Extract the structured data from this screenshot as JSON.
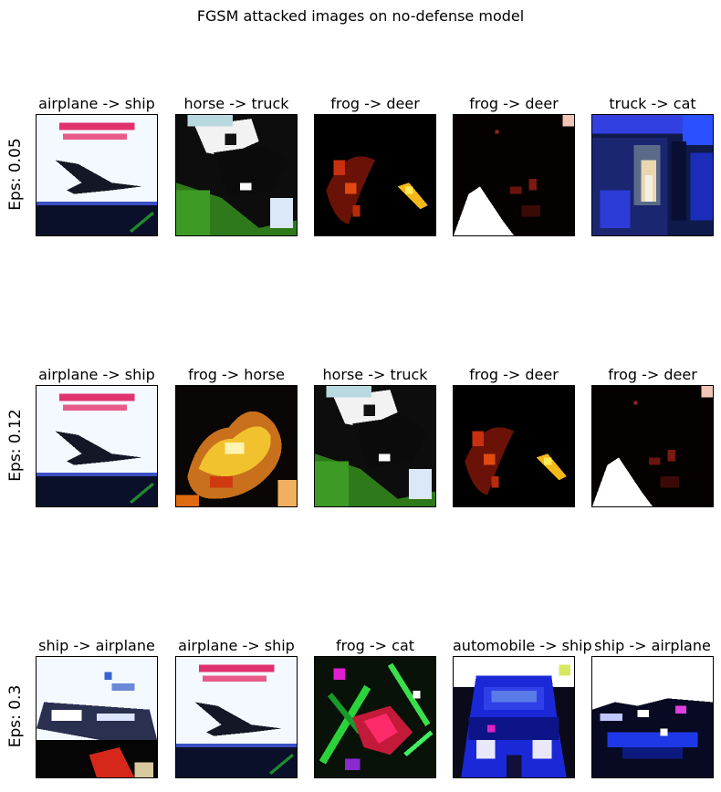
{
  "chart_data": {
    "type": "image_grid",
    "title": "FGSM attacked images on no-defense model",
    "rows": [
      {
        "label": "Eps: 0.05",
        "cells": [
          {
            "title": "airplane -> ship",
            "motif": "airplane-white"
          },
          {
            "title": "horse -> truck",
            "motif": "horse-green"
          },
          {
            "title": "frog -> deer",
            "motif": "frog-dark"
          },
          {
            "title": "frog -> deer",
            "motif": "frog-dark-white"
          },
          {
            "title": "truck -> cat",
            "motif": "truck-blue"
          }
        ]
      },
      {
        "label": "Eps: 0.12",
        "cells": [
          {
            "title": "airplane -> ship",
            "motif": "airplane-white"
          },
          {
            "title": "frog -> horse",
            "motif": "frog-yellow"
          },
          {
            "title": "horse -> truck",
            "motif": "horse-green"
          },
          {
            "title": "frog -> deer",
            "motif": "frog-dark"
          },
          {
            "title": "frog -> deer",
            "motif": "frog-dark-white"
          }
        ]
      },
      {
        "label": "Eps: 0.3",
        "cells": [
          {
            "title": "ship -> airplane",
            "motif": "ship-white"
          },
          {
            "title": "airplane -> ship",
            "motif": "airplane-white"
          },
          {
            "title": "frog -> cat",
            "motif": "frog-green-red"
          },
          {
            "title": "automobile -> ship",
            "motif": "car-blue"
          },
          {
            "title": "ship -> airplane",
            "motif": "ship-white-sky"
          }
        ]
      }
    ]
  }
}
